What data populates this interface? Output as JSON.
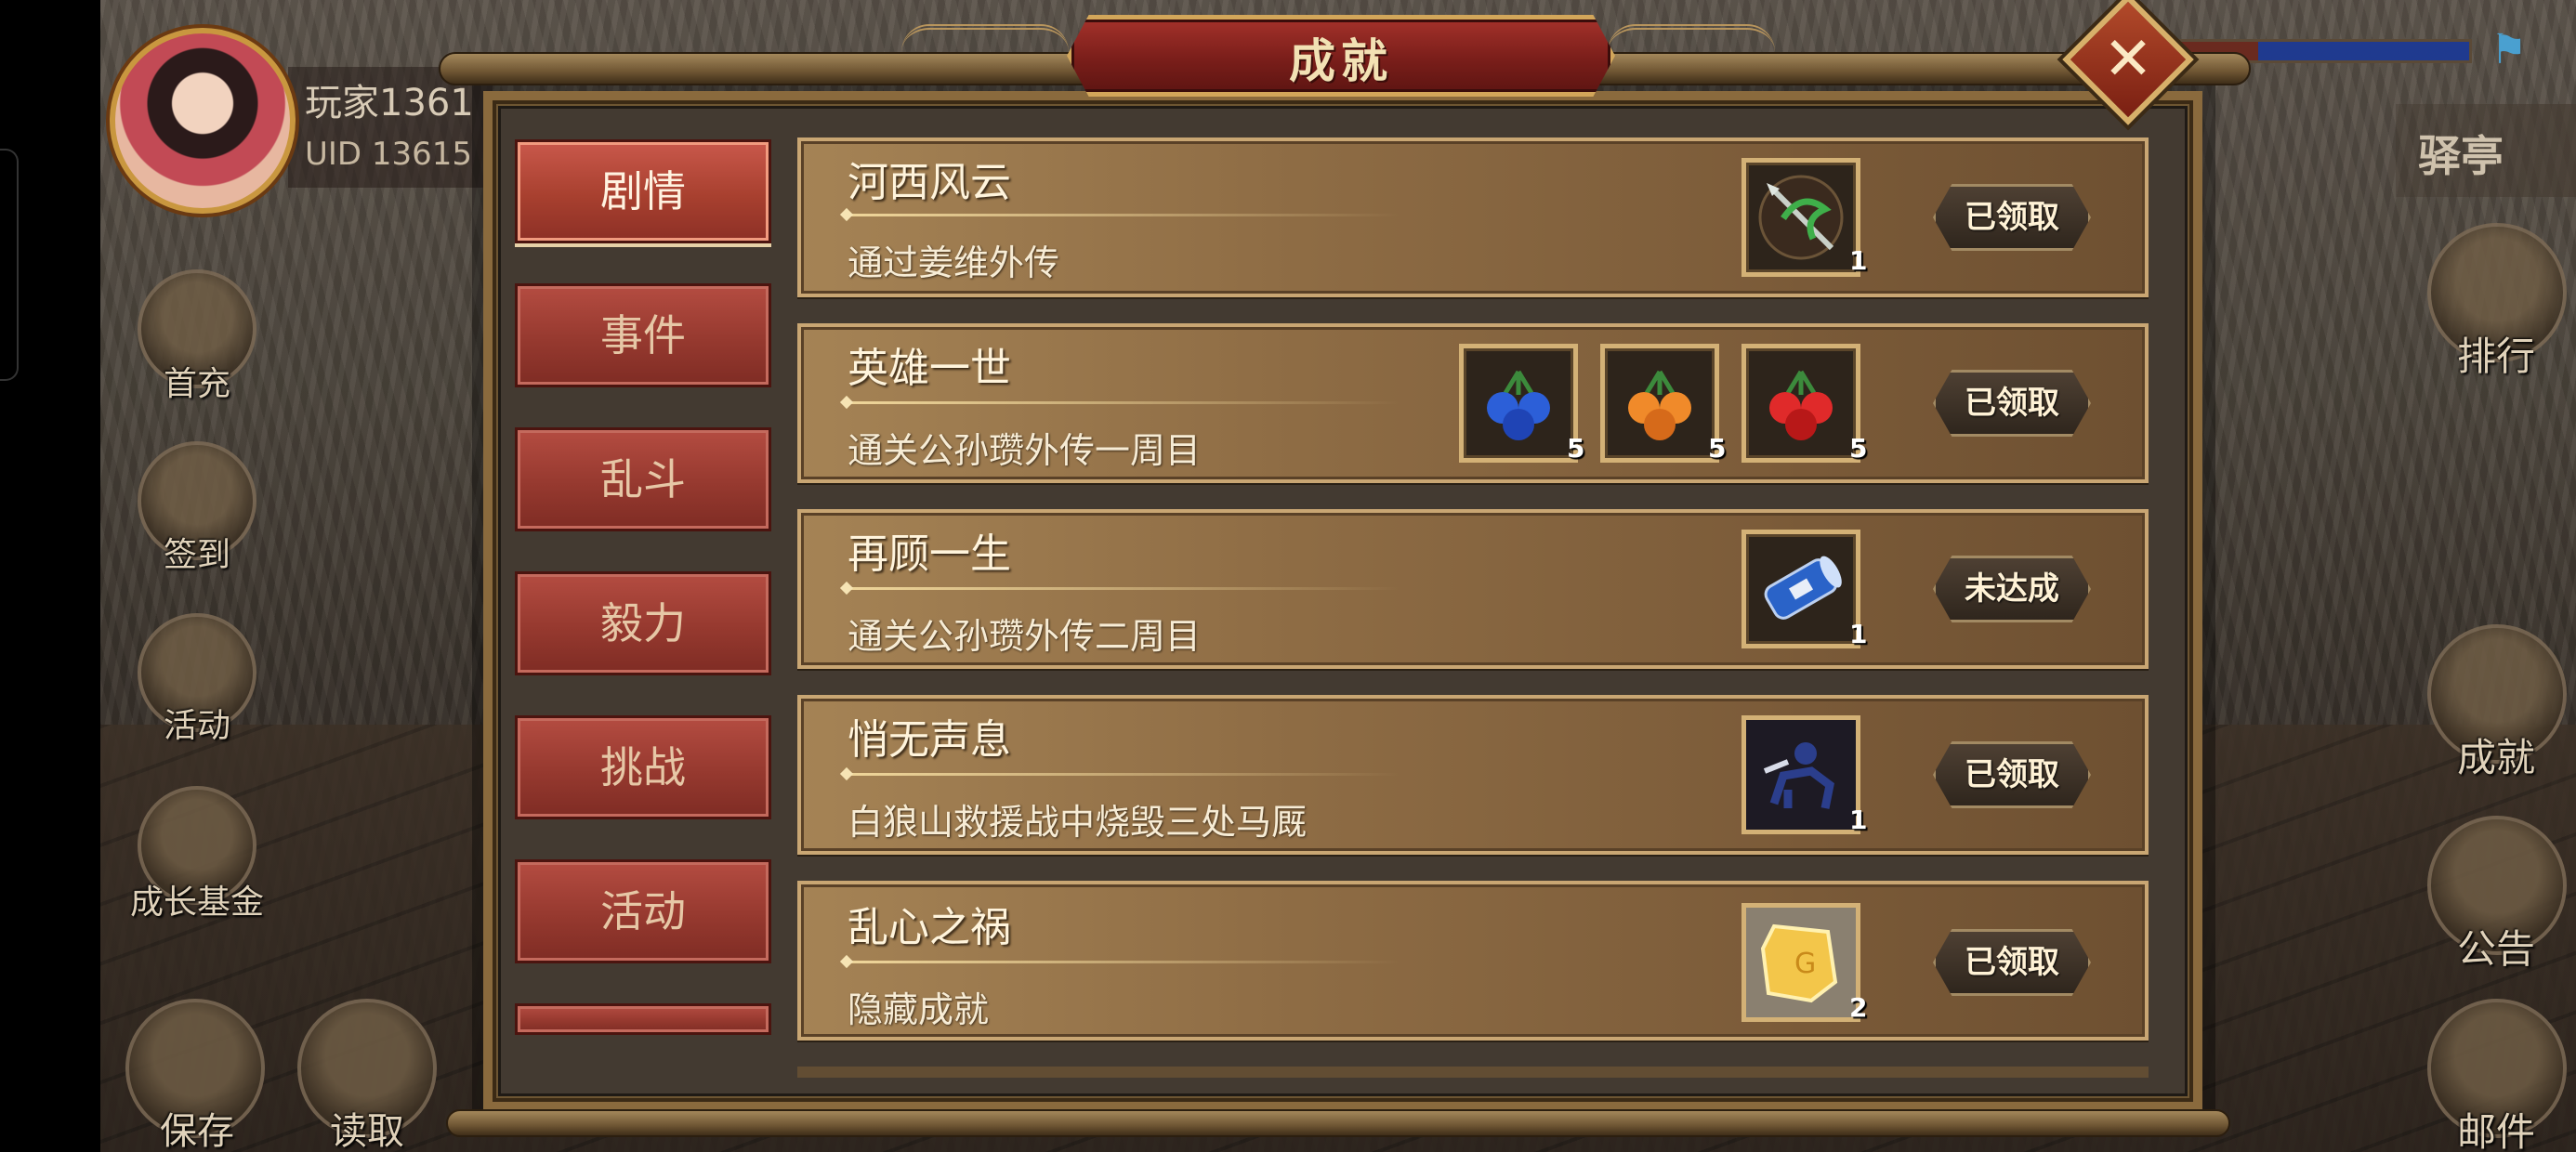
{
  "player": {
    "name": "玩家1361",
    "uid": "UID  13615"
  },
  "location": "驿亭",
  "left_menu": [
    {
      "name": "first-charge",
      "label": "首充"
    },
    {
      "name": "sign-in",
      "label": "签到"
    },
    {
      "name": "events",
      "label": "活动"
    },
    {
      "name": "growth-fund",
      "label": "成长基金"
    }
  ],
  "right_menu": [
    {
      "name": "ranking",
      "label": "排行"
    },
    {
      "name": "achievements",
      "label": "成就"
    },
    {
      "name": "notice",
      "label": "公告"
    },
    {
      "name": "mail",
      "label": "邮件"
    }
  ],
  "bottom_menu": [
    {
      "name": "save",
      "label": "保存"
    },
    {
      "name": "load",
      "label": "读取"
    }
  ],
  "panel": {
    "title": "成就",
    "close_icon": "close-x-icon",
    "tabs": [
      "剧情",
      "事件",
      "乱斗",
      "毅力",
      "挑战",
      "活动"
    ],
    "active_tab": "剧情",
    "achievements": [
      {
        "title": "河西风云",
        "description": "通过姜维外传",
        "rewards": [
          {
            "icon": "green-spear-icon",
            "count": "1"
          }
        ],
        "status": "已领取"
      },
      {
        "title": "英雄一世",
        "description": "通关公孙瓒外传一周目",
        "rewards": [
          {
            "icon": "blue-fruit-icon",
            "count": "5"
          },
          {
            "icon": "orange-fruit-icon",
            "count": "5"
          },
          {
            "icon": "red-fruit-icon",
            "count": "5"
          }
        ],
        "status": "已领取"
      },
      {
        "title": "再顾一生",
        "description": "通关公孙瓒外传二周目",
        "rewards": [
          {
            "icon": "blue-scroll-icon",
            "count": "1"
          }
        ],
        "status": "未达成"
      },
      {
        "title": "悄无声息",
        "description": "白狼山救援战中烧毁三处马厩",
        "rewards": [
          {
            "icon": "cavalry-unit-icon",
            "count": "1"
          }
        ],
        "status": "已领取"
      },
      {
        "title": "乱心之祸",
        "description": "隐藏成就",
        "rewards": [
          {
            "icon": "gold-gem-icon",
            "count": "2"
          }
        ],
        "status": "已领取"
      }
    ]
  }
}
